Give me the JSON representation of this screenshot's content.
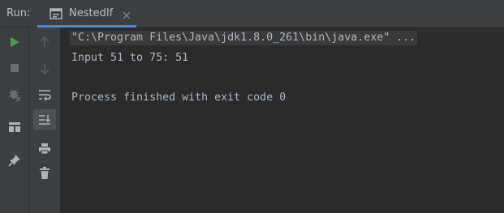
{
  "header": {
    "run_label": "Run:",
    "tab": {
      "label": "NestedIf",
      "icon": "console-window-icon",
      "close_icon": "close-icon"
    }
  },
  "toolbar_primary": [
    {
      "name": "rerun-icon",
      "color": "#499c54"
    },
    {
      "name": "stop-icon",
      "color": "#6e6e6e"
    },
    {
      "name": "debug-disabled-icon",
      "color": "#6e6e6e"
    },
    {
      "name": "layout-icon",
      "color": "#afb1b3"
    },
    {
      "name": "pin-icon",
      "color": "#afb1b3"
    }
  ],
  "toolbar_secondary": [
    {
      "name": "up-arrow-icon",
      "color": "#5a5d5f"
    },
    {
      "name": "down-arrow-icon",
      "color": "#5a5d5f"
    },
    {
      "name": "soft-wrap-icon",
      "color": "#afb1b3"
    },
    {
      "name": "scroll-to-end-icon",
      "color": "#afb1b3",
      "active": true
    },
    {
      "name": "print-icon",
      "color": "#afb1b3"
    },
    {
      "name": "trash-icon",
      "color": "#afb1b3"
    }
  ],
  "console": {
    "lines": [
      "\"C:\\Program Files\\Java\\jdk1.8.0_261\\bin\\java.exe\" ...",
      "Input 51 to 75: 51",
      "",
      "Process finished with exit code 0"
    ]
  },
  "colors": {
    "background": "#2b2b2b",
    "panel": "#3c3f41",
    "accent": "#4a88c7",
    "text": "#a9b7c6"
  }
}
